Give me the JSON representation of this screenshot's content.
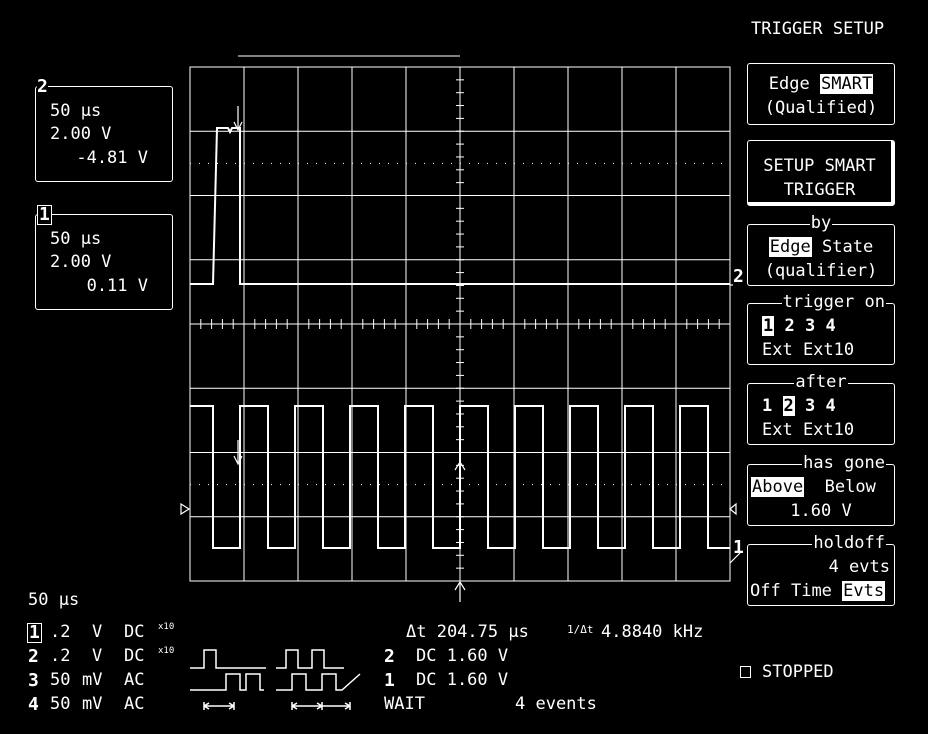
{
  "title": "TRIGGER SETUP",
  "channel_boxes": [
    {
      "label": "2",
      "timebase": "50 μs",
      "volts_div": "2.00 V",
      "offset": "-4.81 V"
    },
    {
      "label": "1",
      "timebase": "50 μs",
      "volts_div": "2.00 V",
      "offset": "0.11 V"
    }
  ],
  "menus": {
    "edge_smart": {
      "edge": "Edge",
      "smart": "SMART",
      "qualified": "(Qualified)"
    },
    "setup": {
      "line1": "SETUP SMART",
      "line2": "TRIGGER"
    },
    "by": {
      "legend": "by",
      "edge": "Edge",
      "state": "State",
      "qualifier": "(qualifier)"
    },
    "trigger_on": {
      "legend": "trigger on",
      "ch1": "1",
      "rest": "2 3 4",
      "ext": "Ext Ext10"
    },
    "after": {
      "legend": "after",
      "ch1": "1",
      "ch2": "2",
      "rest": "3 4",
      "ext": "Ext Ext10"
    },
    "has_gone": {
      "legend": "has gone",
      "above": "Above",
      "below": "Below",
      "level": "1.60 V"
    },
    "holdoff": {
      "legend": "holdoff",
      "count": "4 evts",
      "off": "Off",
      "time": "Time",
      "evts": "Evts"
    }
  },
  "trace_markers": {
    "ch2": "2",
    "ch1": "1"
  },
  "bottom": {
    "timebase": "50 μs",
    "channels": [
      {
        "num": "1",
        "scale": ".2",
        "unit": "V",
        "coupling": "DC",
        "mult": "x10"
      },
      {
        "num": "2",
        "scale": ".2",
        "unit": "V",
        "coupling": "DC",
        "mult": "x10"
      },
      {
        "num": "3",
        "scale": "50",
        "unit": "mV",
        "coupling": "AC",
        "mult": ""
      },
      {
        "num": "4",
        "scale": "50",
        "unit": "mV",
        "coupling": "AC",
        "mult": ""
      }
    ],
    "delta_t": "Δt 204.75 μs",
    "inv_delta": "1/Δt",
    "frequency": "4.8840 kHz",
    "trig_levels": [
      {
        "ch": "2",
        "text": "DC 1.60 V"
      },
      {
        "ch": "1",
        "text": "DC 1.60 V"
      }
    ],
    "wait": "WAIT",
    "events": "4 events",
    "status": "STOPPED"
  }
}
